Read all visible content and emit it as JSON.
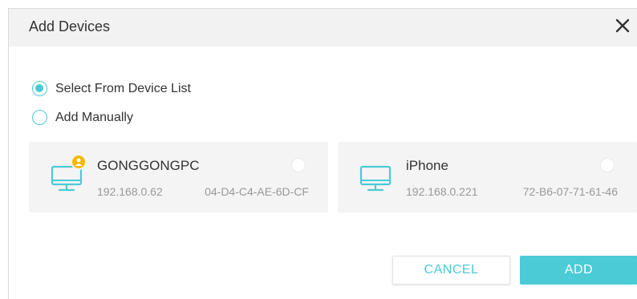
{
  "dialog": {
    "title": "Add Devices",
    "close_icon": "close-icon"
  },
  "mode": {
    "options": [
      {
        "label": "Select From Device List",
        "selected": true
      },
      {
        "label": "Add Manually",
        "selected": false
      }
    ]
  },
  "devices": [
    {
      "name": "GONGGONGPC",
      "ip": "192.168.0.62",
      "mac": "04-D4-C4-AE-6D-CF",
      "icon": "monitor-icon",
      "badge_icon": "user-badge-icon",
      "selected": false
    },
    {
      "name": "iPhone",
      "ip": "192.168.0.221",
      "mac": "72-B6-07-71-61-46",
      "icon": "monitor-icon",
      "selected": false
    }
  ],
  "buttons": {
    "cancel_label": "CANCEL",
    "add_label": "ADD"
  },
  "colors": {
    "accent": "#4acbd6",
    "badge": "#f5b800",
    "header_bg": "#f2f2f2",
    "card_bg": "#f4f4f4"
  }
}
